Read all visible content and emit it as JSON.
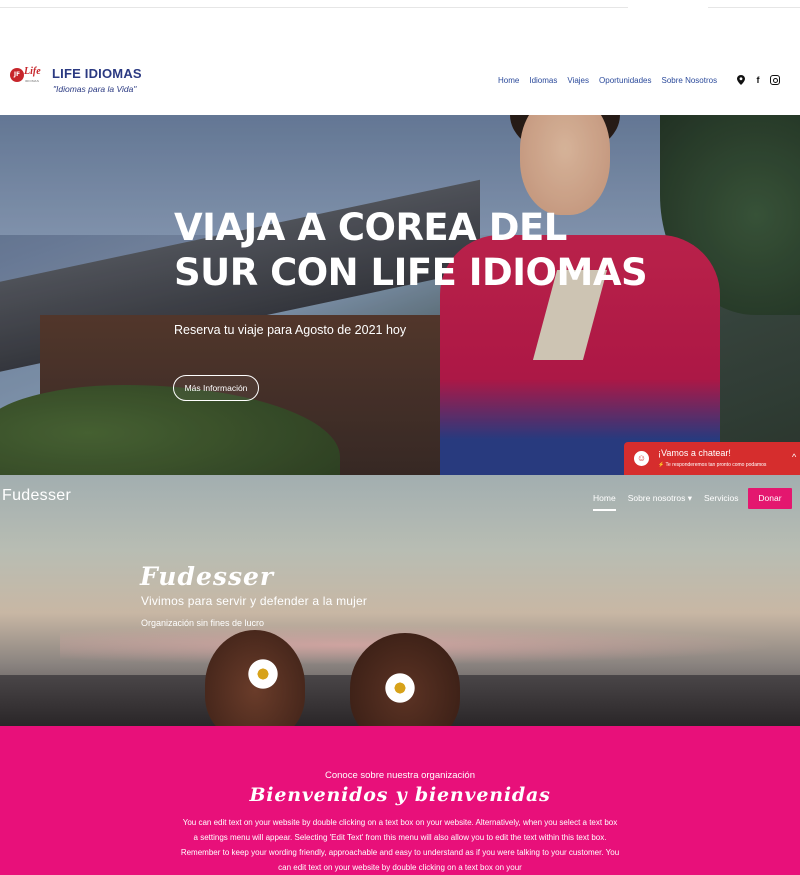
{
  "header": {
    "logo_badge": "JF",
    "logo_word": "Life",
    "logo_sub": "IDIOMAS",
    "brand_title": "LIFE IDIOMAS",
    "slogan": "\"Idiomas para la Vida\"",
    "nav": [
      "Home",
      "Idiomas",
      "Viajes",
      "Oportunidades",
      "Sobre Nosotros"
    ],
    "social_icons": [
      "location-pin-icon",
      "facebook-icon",
      "instagram-icon"
    ]
  },
  "hero1": {
    "title": "VIAJA A COREA DEL SUR CON LIFE IDIOMAS",
    "subtitle": "Reserva tu viaje para Agosto de 2021 hoy",
    "button_label": "Más Información"
  },
  "chat": {
    "title": "¡Vamos a chatear!",
    "subtitle": "Te responderemos tan pronto como podamos",
    "color": "#d62d2d"
  },
  "hero2": {
    "brand": "Fudesser",
    "nav": [
      "Home",
      "Sobre nosotros",
      "Servicios"
    ],
    "active_nav": "Home",
    "donate_label": "Donar",
    "title": "Fudesser",
    "subtitle": "Vivimos para servir y defender a la mujer",
    "tagline": "Organización sin fines de lucro",
    "accent_color": "#e4176f"
  },
  "about": {
    "kicker": "Conoce sobre nuestra organización",
    "title": "Bienvenidos y bienvenidas",
    "body": "You can edit text on your website by double clicking on a text box on your website. Alternatively, when you select a text box a settings menu will appear. Selecting 'Edit Text' from this menu will also allow you to edit the text within this text box. Remember to keep your wording friendly, approachable and easy to understand as if you were talking to your customer. You can edit text on your website by double clicking on a text box on your",
    "background_color": "#e8107a"
  }
}
